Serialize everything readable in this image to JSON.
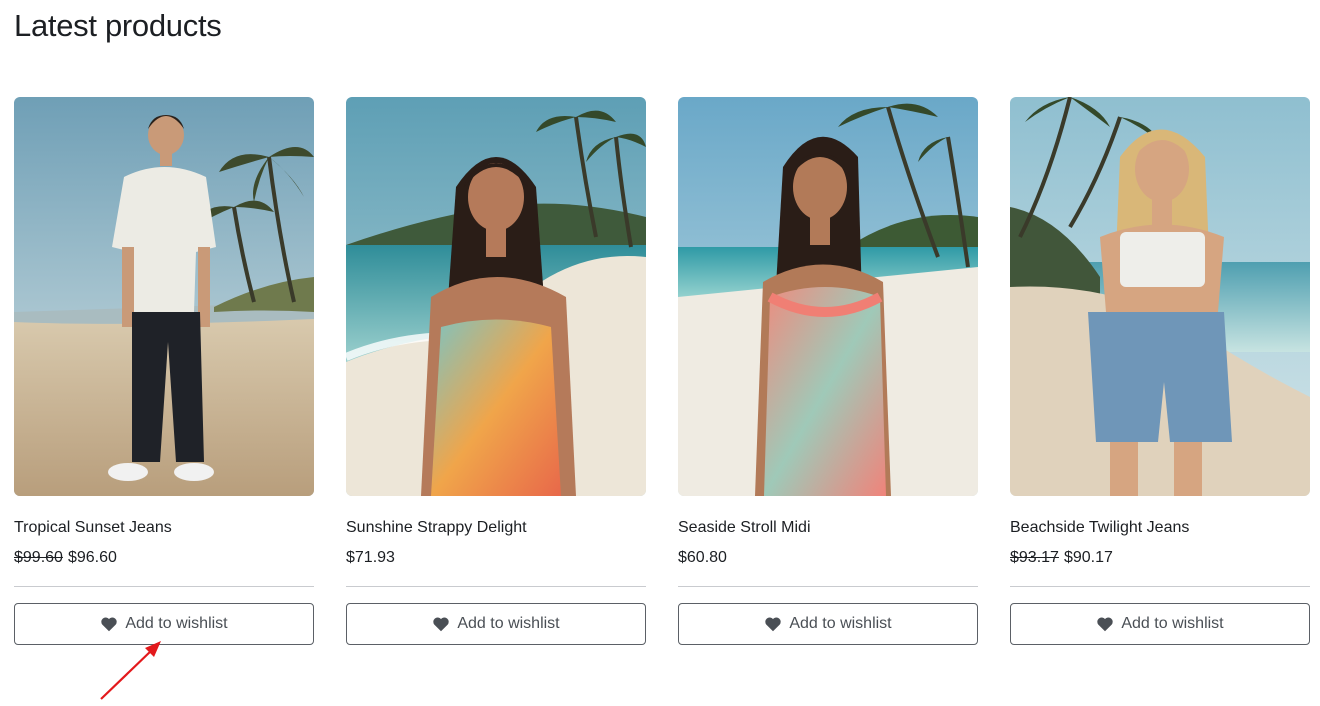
{
  "section": {
    "title": "Latest products"
  },
  "products": [
    {
      "name": "Tropical Sunset Jeans",
      "old_price": "$99.60",
      "price": "$96.60",
      "wishlist_label": "Add to wishlist",
      "icon": "heart-icon"
    },
    {
      "name": "Sunshine Strappy Delight",
      "old_price": "",
      "price": "$71.93",
      "wishlist_label": "Add to wishlist",
      "icon": "heart-icon"
    },
    {
      "name": "Seaside Stroll Midi",
      "old_price": "",
      "price": "$60.80",
      "wishlist_label": "Add to wishlist",
      "icon": "heart-icon"
    },
    {
      "name": "Beachside Twilight Jeans",
      "old_price": "$93.17",
      "price": "$90.17",
      "wishlist_label": "Add to wishlist",
      "icon": "heart-icon"
    }
  ],
  "colors": {
    "text": "#1c1f23",
    "button_border": "#5b6066",
    "annotation_arrow": "#e3191c"
  }
}
